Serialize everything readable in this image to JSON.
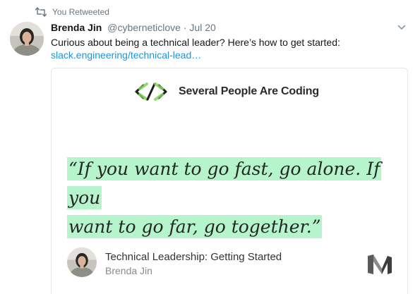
{
  "retweet": {
    "label": "You Retweeted",
    "icon": "retweet-icon"
  },
  "tweet": {
    "display_name": "Brenda Jin",
    "handle": "@cyberneticlove",
    "separator": "·",
    "date": "Jul 20",
    "text": "Curious about being a technical leader? Here’s how to get started:",
    "link": "slack.engineering/technical-lead…"
  },
  "card": {
    "publication": "Several People Are Coding",
    "quote_line1": "“If you want to go fast, go alone. If you",
    "quote_line2": "want to go far, go together.”",
    "title": "Technical Leadership: Getting Started",
    "author": "Brenda Jin",
    "highlight_color": "#b6f5cc"
  },
  "colors": {
    "link": "#1b95e0",
    "secondary_text": "#657786"
  }
}
